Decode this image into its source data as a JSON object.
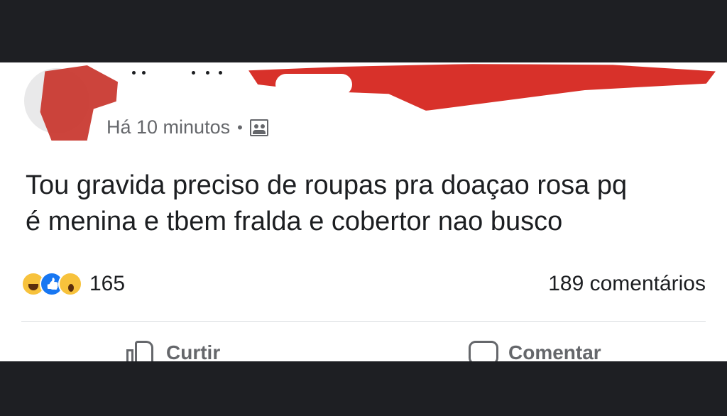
{
  "post": {
    "timestamp": "Há 10 minutos",
    "separator": "•",
    "audience_icon": "group-audience-icon",
    "text_line1": "Tou gravida preciso de roupas pra doaçao rosa pq",
    "text_line2": "é menina e tbem fralda e cobertor nao busco",
    "reactions": {
      "types": [
        "haha",
        "like",
        "wow"
      ],
      "count": "165"
    },
    "comments_count": "189 comentários",
    "actions": {
      "like_label": "Curtir",
      "comment_label": "Comentar"
    }
  },
  "colors": {
    "redaction": "#d8312a",
    "like_blue": "#1877f2",
    "emoji_yellow": "#f7c23c",
    "meta_gray": "#65676b",
    "text": "#1c1e21",
    "frame": "#1e1f23"
  }
}
